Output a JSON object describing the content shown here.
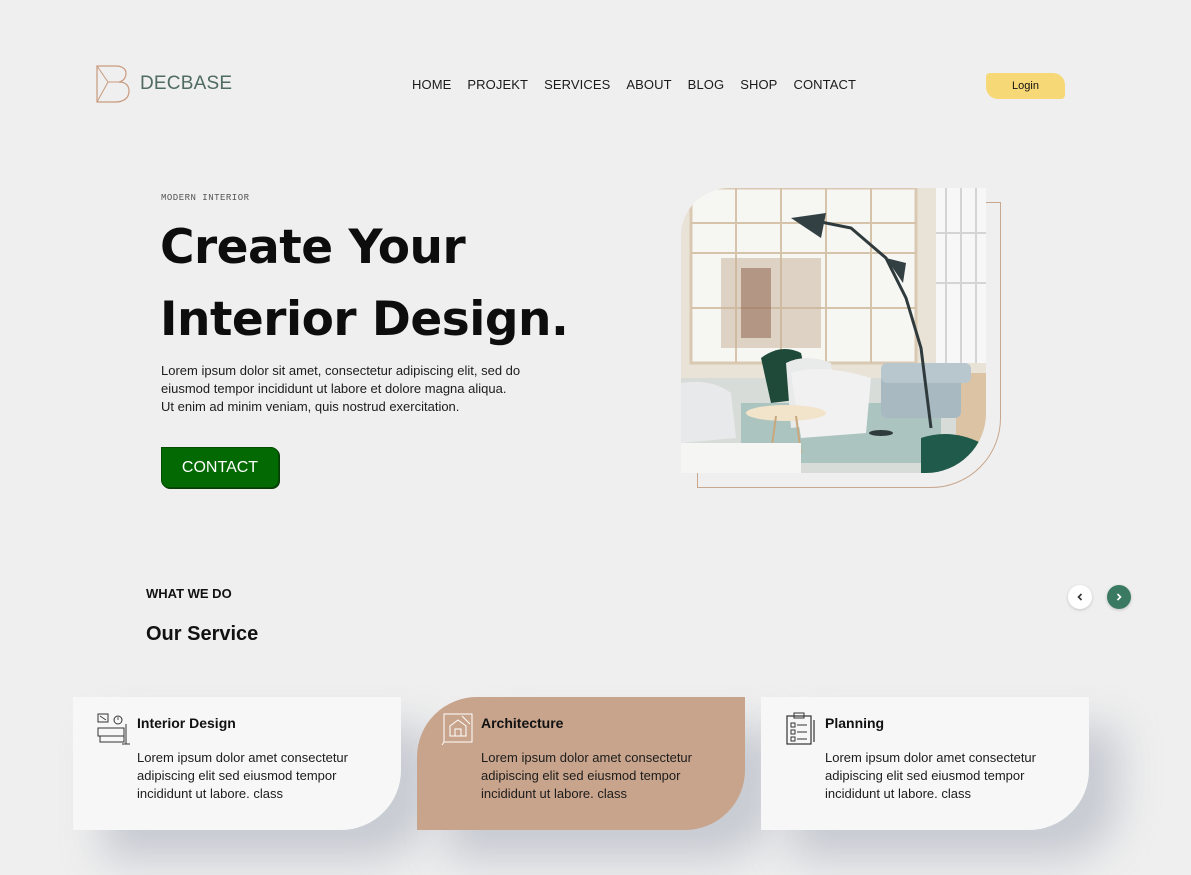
{
  "brand": {
    "name": "DECBASE"
  },
  "nav": {
    "items": [
      "HOME",
      "PROJEKT",
      "SERVICES",
      "ABOUT",
      "BLOG",
      "SHOP",
      "CONTACT"
    ]
  },
  "login": {
    "label": "Login"
  },
  "hero": {
    "eyebrow": "MODERN INTERIOR",
    "title": "Create Your Interior Design.",
    "description": "Lorem ipsum dolor sit amet, consectetur adipiscing elit, sed do eiusmod tempor incididunt ut labore et dolore magna aliqua. Ut enim ad minim veniam, quis nostrud exercitation.",
    "cta_label": "CONTACT"
  },
  "services": {
    "eyebrow": "WHAT WE DO",
    "heading": "Our Service",
    "prev_icon": "chevron-left-icon",
    "next_icon": "chevron-right-icon",
    "cards": [
      {
        "title": "Interior Design",
        "description": "Lorem ipsum dolor amet consectetur adipiscing elit sed eiusmod tempor incididunt ut labore. class",
        "icon": "furniture-icon"
      },
      {
        "title": "Architecture",
        "description": "Lorem ipsum dolor amet consectetur adipiscing elit sed eiusmod tempor incididunt ut labore. class",
        "icon": "blueprint-icon"
      },
      {
        "title": "Planning",
        "description": "Lorem ipsum dolor amet consectetur adipiscing elit sed eiusmod tempor incididunt ut labore. class",
        "icon": "clipboard-icon"
      }
    ]
  },
  "colors": {
    "background": "#efefef",
    "accent_yellow": "#f7d877",
    "accent_green": "#036a03",
    "accent_tan": "#c8a48c",
    "brand_teal": "#4f6b62"
  }
}
